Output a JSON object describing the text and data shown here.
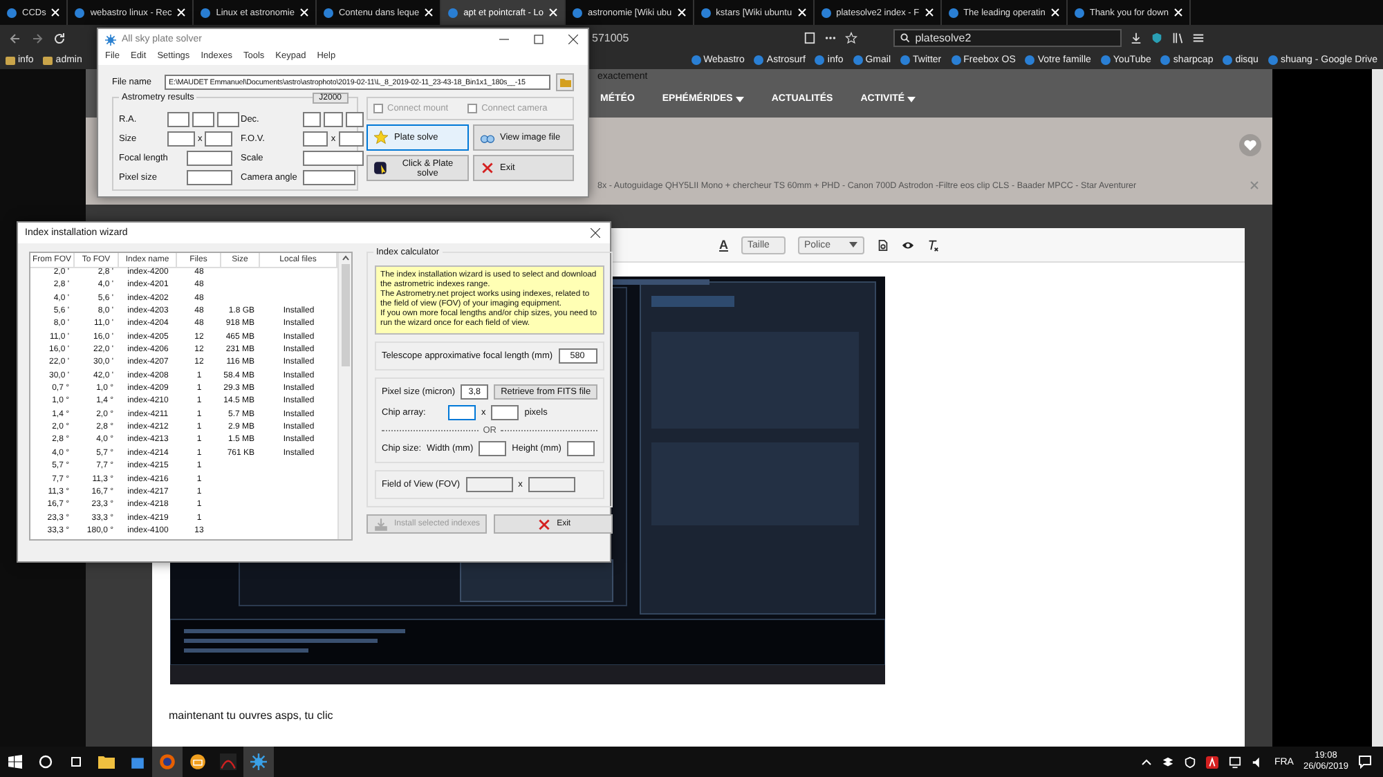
{
  "browser": {
    "tabs": [
      {
        "label": "CCDs",
        "selected": false
      },
      {
        "label": "webastro linux - Rec",
        "selected": false
      },
      {
        "label": "Linux et astronomie",
        "selected": false
      },
      {
        "label": "Contenu dans leque",
        "selected": false
      },
      {
        "label": "apt et pointcraft - Lo",
        "selected": true
      },
      {
        "label": "astronomie [Wiki ubu",
        "selected": false
      },
      {
        "label": "kstars [Wiki ubuntu",
        "selected": false
      },
      {
        "label": "platesolve2 index - F",
        "selected": false
      },
      {
        "label": "The leading operatin",
        "selected": false
      },
      {
        "label": "Thank you for down",
        "selected": false
      }
    ],
    "address": "571005",
    "search": "platesolve2",
    "bookmarks_left": [
      "info",
      "admin"
    ],
    "bookmarks_right": [
      "Webastro",
      "Astrosurf",
      "info",
      "Gmail",
      "Twitter",
      "Freebox OS",
      "Votre famille",
      "YouTube",
      "sharpcap",
      "disqu",
      "shuang - Google Drive"
    ]
  },
  "site": {
    "heading": "exactement",
    "menu": [
      {
        "label": "MÉTÉO",
        "dropdown": false
      },
      {
        "label": "EPHÉMÉRIDES",
        "dropdown": true
      },
      {
        "label": "ACTUALITÉS",
        "dropdown": false
      },
      {
        "label": "ACTIVITÉ",
        "dropdown": true
      }
    ],
    "signature": "8x - Autoguidage QHY5LII Mono + chercheur TS 60mm + PHD - Canon 700D Astrodon -Filtre eos clip CLS - Baader MPCC - Star Aventurer",
    "toolbar": {
      "text_color_label": "A",
      "size": "Taille",
      "font": "Police"
    },
    "post_text": "maintenant tu ouvres asps, tu clic"
  },
  "plate_solver": {
    "title": "All sky plate solver",
    "menu": [
      "File",
      "Edit",
      "Settings",
      "Indexes",
      "Tools",
      "Keypad",
      "Help"
    ],
    "file_label": "File name",
    "file_value": "E:\\MAUDET Emmanuel\\Documents\\astro\\astrophoto\\2019-02-11\\L_8_2019-02-11_23-43-18_Bin1x1_180s__-15",
    "group": "Astrometry results",
    "epoch": "J2000",
    "labels": {
      "ra": "R.A.",
      "dec": "Dec.",
      "size": "Size",
      "size_x": "x",
      "fov": "F.O.V.",
      "fov_x": "x",
      "focal": "Focal length",
      "scale": "Scale",
      "pixel": "Pixel size",
      "angle": "Camera angle"
    },
    "checkboxes": [
      {
        "label": "Connect mount",
        "checked": false,
        "disabled": true
      },
      {
        "label": "Connect camera",
        "checked": false,
        "disabled": true
      }
    ],
    "buttons": [
      {
        "label": "Plate solve",
        "kind": "star",
        "focused": true
      },
      {
        "label": "View image file",
        "kind": "view",
        "focused": false
      },
      {
        "label": "Click & Plate solve",
        "kind": "click",
        "focused": false
      },
      {
        "label": "Exit",
        "kind": "exit",
        "focused": false
      }
    ]
  },
  "index_wizard": {
    "title": "Index installation wizard",
    "columns": [
      "From FOV",
      "To FOV",
      "Index name",
      "Files",
      "Size",
      "Local files"
    ],
    "rows": [
      [
        "2,0 '",
        "2,8 '",
        "index-4200",
        "48",
        "",
        ""
      ],
      [
        "2,8 '",
        "4,0 '",
        "index-4201",
        "48",
        "",
        ""
      ],
      [
        "4,0 '",
        "5,6 '",
        "index-4202",
        "48",
        "",
        ""
      ],
      [
        "5,6 '",
        "8,0 '",
        "index-4203",
        "48",
        "1.8 GB",
        "Installed"
      ],
      [
        "8,0 '",
        "11,0 '",
        "index-4204",
        "48",
        "918 MB",
        "Installed"
      ],
      [
        "11,0 '",
        "16,0 '",
        "index-4205",
        "12",
        "465 MB",
        "Installed"
      ],
      [
        "16,0 '",
        "22,0 '",
        "index-4206",
        "12",
        "231 MB",
        "Installed"
      ],
      [
        "22,0 '",
        "30,0 '",
        "index-4207",
        "12",
        "116 MB",
        "Installed"
      ],
      [
        "30,0 '",
        "42,0 '",
        "index-4208",
        "1",
        "58.4 MB",
        "Installed"
      ],
      [
        "0,7 °",
        "1,0 °",
        "index-4209",
        "1",
        "29.3 MB",
        "Installed"
      ],
      [
        "1,0 °",
        "1,4 °",
        "index-4210",
        "1",
        "14.5 MB",
        "Installed"
      ],
      [
        "1,4 °",
        "2,0 °",
        "index-4211",
        "1",
        "5.7 MB",
        "Installed"
      ],
      [
        "2,0 °",
        "2,8 °",
        "index-4212",
        "1",
        "2.9 MB",
        "Installed"
      ],
      [
        "2,8 °",
        "4,0 °",
        "index-4213",
        "1",
        "1.5 MB",
        "Installed"
      ],
      [
        "4,0 °",
        "5,7 °",
        "index-4214",
        "1",
        "761 KB",
        "Installed"
      ],
      [
        "5,7 °",
        "7,7 °",
        "index-4215",
        "1",
        "",
        ""
      ],
      [
        "7,7 °",
        "11,3 °",
        "index-4216",
        "1",
        "",
        ""
      ],
      [
        "11,3 °",
        "16,7 °",
        "index-4217",
        "1",
        "",
        ""
      ],
      [
        "16,7 °",
        "23,3 °",
        "index-4218",
        "1",
        "",
        ""
      ],
      [
        "23,3 °",
        "33,3 °",
        "index-4219",
        "1",
        "",
        ""
      ],
      [
        "33,3 °",
        "180,0 °",
        "index-4100",
        "13",
        "",
        ""
      ]
    ],
    "calculator": {
      "title": "Index calculator",
      "info": "The index installation wizard is used to select and download the astrometric indexes range.\nThe Astrometry.net project works using indexes, related to the field of view (FOV) of your imaging equipment.\nIf you own more focal lengths and/or chip sizes, you need to run the wizard once for each field of view.",
      "focal_label": "Telescope approximative focal length (mm)",
      "focal_value": "580",
      "pixel_label": "Pixel size (micron)",
      "pixel_value": "3,8",
      "retrieve": "Retrieve from FITS file",
      "chip_label": "Chip array:",
      "chip_x": "x",
      "chip_unit": "pixels",
      "or": "OR",
      "size_label": "Chip size:",
      "width_label": "Width (mm)",
      "height_label": "Height (mm)",
      "fov_label": "Field of View  (FOV)",
      "fov_x": "x"
    },
    "buttons": [
      {
        "label": "Install selected indexes",
        "kind": "install",
        "disabled": true
      },
      {
        "label": "Exit",
        "kind": "exit",
        "disabled": false
      }
    ]
  },
  "taskbar": {
    "language": "FRA",
    "time": "19:08",
    "date": "26/06/2019"
  }
}
